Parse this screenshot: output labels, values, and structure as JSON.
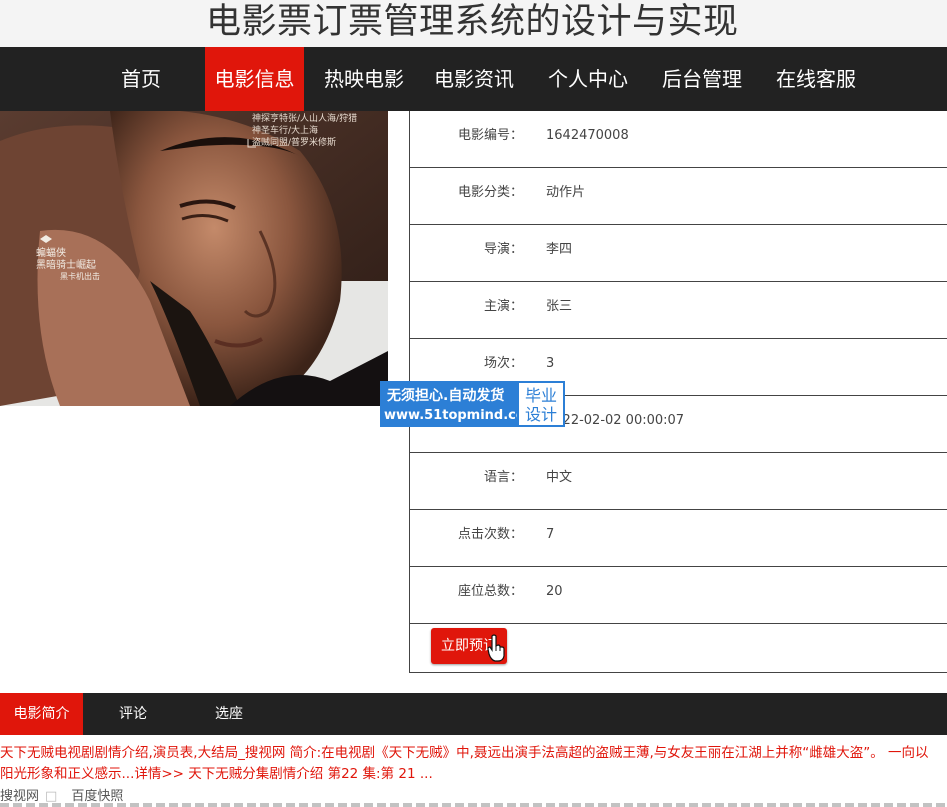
{
  "site_title": "电影票订票管理系统的设计与实现",
  "nav": [
    {
      "label": "首页"
    },
    {
      "label": "电影信息",
      "active": true
    },
    {
      "label": "热映电影"
    },
    {
      "label": "电影资讯"
    },
    {
      "label": "个人中心"
    },
    {
      "label": "后台管理"
    },
    {
      "label": "在线客服"
    }
  ],
  "poster": {
    "caption_lines": [
      "神探亨特张/人山人海/狩猎",
      "神圣车行/大上海",
      "盗贼同盟/普罗米修斯"
    ],
    "side_text_lines": [
      "蝙蝠侠",
      "黑暗骑士崛起",
      "黑卡机出击"
    ]
  },
  "details": [
    {
      "label": "电影编号：",
      "value": "1642470008"
    },
    {
      "label": "电影分类：",
      "value": "动作片"
    },
    {
      "label": "导演：",
      "value": "李四"
    },
    {
      "label": "主演：",
      "value": "张三"
    },
    {
      "label": "场次：",
      "value": "3"
    },
    {
      "label": "上映时间：",
      "value": "2022-02-02 00:00:07"
    },
    {
      "label": "语言：",
      "value": "中文"
    },
    {
      "label": "点击次数：",
      "value": "7"
    },
    {
      "label": "座位总数：",
      "value": "20"
    }
  ],
  "book_button": "立即预订",
  "watermark": {
    "top": "无须担心.自动发货",
    "bottom": "www.51topmind.com",
    "badge_line1": "毕业",
    "badge_line2": "设计"
  },
  "tabs": [
    {
      "label": "电影简介",
      "active": true
    },
    {
      "label": "评论"
    },
    {
      "label": "选座"
    }
  ],
  "summary": {
    "line1": "天下无贼电视剧剧情介绍,演员表,大结局_搜视网 简介:在电视剧《天下无贼》中,聂远出演手法高超的盗贼王薄,与女友王丽在江湖上并称“雌雄大盗”。 一向以",
    "line2": "阳光形象和正义感示...详情>> 天下无贼分集剧情介绍 第22 集:第 21 ...",
    "source": "搜视网",
    "source_mark": "□",
    "snapshot": "百度快照"
  },
  "colors": {
    "accent": "#e0160b",
    "nav_bg": "#222222",
    "watermark_blue": "#2c7fd6"
  }
}
